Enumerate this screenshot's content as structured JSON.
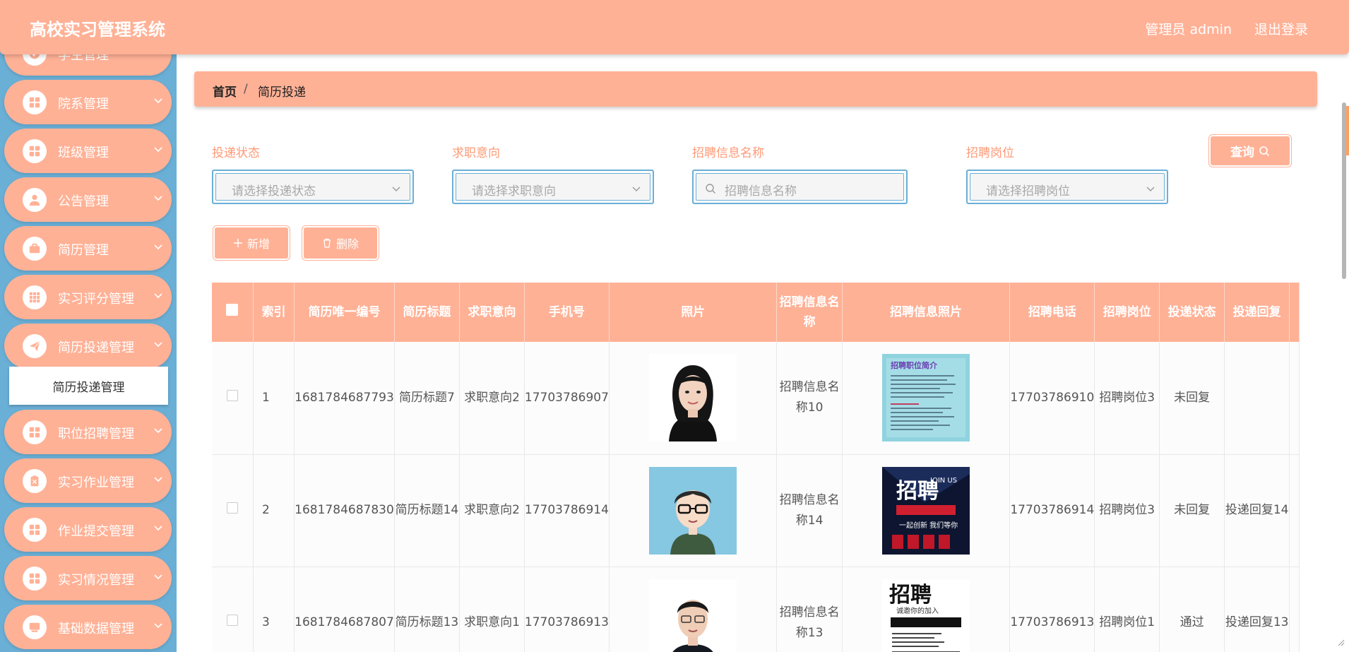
{
  "header": {
    "title": "高校实习管理系统",
    "user": "管理员 admin",
    "logout": "退出登录"
  },
  "sidebar": {
    "items": [
      {
        "label": "学生管理",
        "icon": "check-circle-icon"
      },
      {
        "label": "院系管理",
        "icon": "grid-icon"
      },
      {
        "label": "班级管理",
        "icon": "grid-icon"
      },
      {
        "label": "公告管理",
        "icon": "user-icon"
      },
      {
        "label": "简历管理",
        "icon": "briefcase-icon"
      },
      {
        "label": "实习评分管理",
        "icon": "grid-icon"
      },
      {
        "label": "简历投递管理",
        "icon": "send-icon"
      },
      {
        "label": "职位招聘管理",
        "icon": "grid-icon"
      },
      {
        "label": "实习作业管理",
        "icon": "clipboard-icon"
      },
      {
        "label": "作业提交管理",
        "icon": "grid-icon"
      },
      {
        "label": "实习情况管理",
        "icon": "grid-icon"
      },
      {
        "label": "基础数据管理",
        "icon": "monitor-icon"
      }
    ],
    "sub_active": "简历投递管理"
  },
  "breadcrumb": {
    "home": "首页",
    "sep": "/",
    "current": "简历投递"
  },
  "filters": {
    "status": {
      "label": "投递状态",
      "placeholder": "请选择投递状态"
    },
    "intent": {
      "label": "求职意向",
      "placeholder": "请选择求职意向"
    },
    "info_name": {
      "label": "招聘信息名称",
      "placeholder": "招聘信息名称"
    },
    "position": {
      "label": "招聘岗位",
      "placeholder": "请选择招聘岗位"
    },
    "query_label": "查询"
  },
  "actions": {
    "add_label": "新增",
    "delete_label": "删除"
  },
  "table": {
    "headers": [
      "索引",
      "简历唯一编号",
      "简历标题",
      "求职意向",
      "手机号",
      "照片",
      "招聘信息名称",
      "招聘信息照片",
      "招聘电话",
      "招聘岗位",
      "投递状态",
      "投递回复"
    ],
    "rows": [
      {
        "index": "1",
        "resume_id": "1681784687793",
        "title": "简历标题7",
        "intent": "求职意向2",
        "phone": "17703786907",
        "info_name": "招聘信息名称10",
        "tel": "17703786910",
        "position": "招聘岗位3",
        "status": "未回复",
        "reply": ""
      },
      {
        "index": "2",
        "resume_id": "1681784687830",
        "title": "简历标题14",
        "intent": "求职意向2",
        "phone": "17703786914",
        "info_name": "招聘信息名称14",
        "tel": "17703786914",
        "position": "招聘岗位3",
        "status": "未回复",
        "reply": "投递回复14"
      },
      {
        "index": "3",
        "resume_id": "1681784687807",
        "title": "简历标题13",
        "intent": "求职意向1",
        "phone": "17703786913",
        "info_name": "招聘信息名称13",
        "tel": "17703786913",
        "position": "招聘岗位1",
        "status": "通过",
        "reply": "投递回复13"
      }
    ]
  },
  "poster_text": {
    "p1_title": "招聘职位简介",
    "p2_big": "招聘",
    "p2_join": "JOIN US",
    "p2_slogan": "一起创新 我们等你",
    "p3_big": "招聘",
    "p3_sub": "诚邀你的加入"
  },
  "colors": {
    "accent": "#ffb196",
    "sidebar": "#6aafd6",
    "label": "#ff9a76"
  }
}
